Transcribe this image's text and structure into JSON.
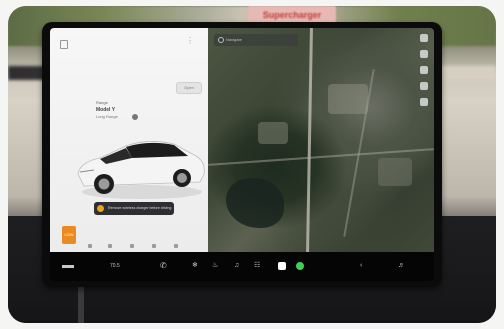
{
  "sign": {
    "text": "Supercharger"
  },
  "car_panel": {
    "label_small": "Range",
    "label_main": "Model Y",
    "label_sub": "Long Range",
    "open_button": "Open",
    "alert_text": "Remove wireless charger before driving",
    "battery_label": "LOW"
  },
  "map": {
    "search_placeholder": "Navigate"
  },
  "taskbar": {
    "temp": "70.5"
  },
  "colors": {
    "battery": "#e98b22",
    "alert_icon": "#e8a31f",
    "phone_icon": "#3ecf5a"
  }
}
